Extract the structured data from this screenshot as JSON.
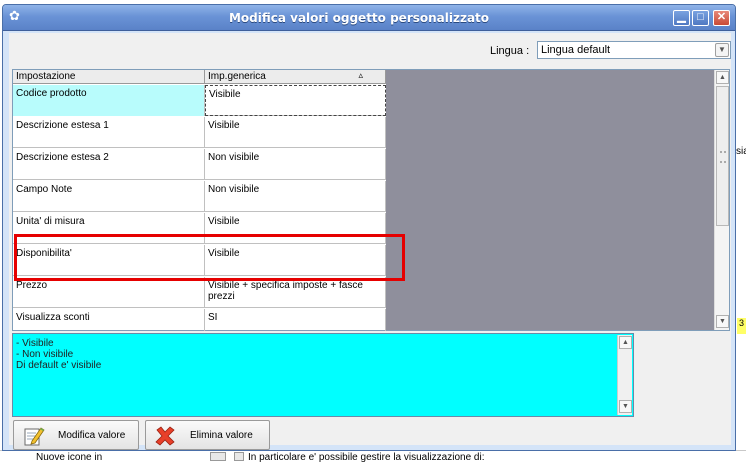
{
  "window": {
    "title": "Modifica valori oggetto personalizzato",
    "buttons": [
      "minimize-icon",
      "maximize-icon",
      "close-icon"
    ]
  },
  "language": {
    "label": "Lingua :",
    "value": "Lingua default"
  },
  "grid": {
    "headers": [
      "Impostazione",
      "Imp.generica"
    ],
    "rows": [
      {
        "setting": "Codice prodotto",
        "value": "Visibile",
        "selected": true
      },
      {
        "setting": "Descrizione estesa 1",
        "value": "Visibile"
      },
      {
        "setting": "Descrizione estesa 2",
        "value": "Non visibile"
      },
      {
        "setting": "Campo Note",
        "value": "Non visibile"
      },
      {
        "setting": "Unita' di misura",
        "value": "Visibile"
      },
      {
        "setting": "Disponibilita'",
        "value": "Visibile",
        "highlighted": true
      },
      {
        "setting": "Prezzo",
        "value": "Visibile + specifica imposte + fasce prezzi"
      },
      {
        "setting": "Visualizza sconti",
        "value": "SI"
      }
    ]
  },
  "memo": {
    "text": "- Visibile\n- Non visibile\nDi default e' visibile"
  },
  "actions": {
    "edit_label": "Modifica valore",
    "delete_label": "Elimina valore"
  },
  "background": {
    "right_text": "sia",
    "yellow_text": "3",
    "bottom_text_left": "Nuove icone in",
    "bottom_text_right": "In particolare e' possibile gestire la visualizzazione di:"
  },
  "colors": {
    "title_bar": "#6a93d6",
    "selected_cell": "#b8fcfc",
    "memo_background": "#00ffff",
    "empty_grid_area": "#8f8f9c",
    "highlight_box": "#e60000"
  }
}
